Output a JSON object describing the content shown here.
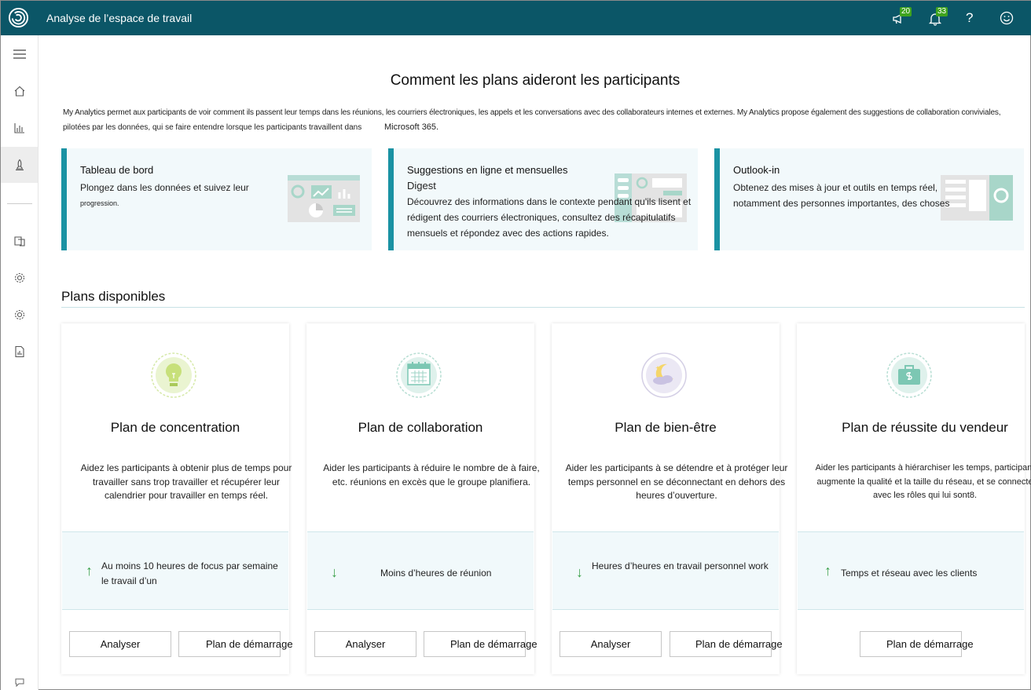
{
  "app": {
    "title": "Analyse de l’espace de travail"
  },
  "topbar": {
    "announcements_badge": "20",
    "notifications_badge": "33",
    "help_label": "?"
  },
  "page": {
    "title": "Comment les plans aideront les participants",
    "intro_line1": "My Analytics permet aux participants de voir comment ils passent leur temps dans les réunions, les courriers électroniques, les appels et les conversations avec des collaborateurs internes et externes. My Analytics propose également des suggestions de collaboration conviviales,",
    "intro_line2": "pilotées par les données, qui se faire entendre lorsque les participants travaillent dans",
    "intro_product": "Microsoft 365."
  },
  "features": [
    {
      "title": "Tableau de bord",
      "description": "Plongez dans les données et suivez leur",
      "description_small": "progression."
    },
    {
      "title": "Suggestions en ligne et mensuelles",
      "subtitle": "Digest",
      "description": "Découvrez des informations dans le contexte pendant qu'ils lisent et rédigent des courriers électroniques, consultez des récapitulatifs mensuels et répondez avec des actions rapides."
    },
    {
      "title": "Outlook-in",
      "description": "Obtenez des mises à jour et outils en temps réel, notamment des personnes importantes, des choses"
    }
  ],
  "plans_section": {
    "title": "Plans disponibles"
  },
  "plans": [
    {
      "title": "Plan de concentration",
      "description": "Aidez les participants à obtenir plus de temps pour travailler sans trop travailler et récupérer leur calendrier pour travailler en temps réel.",
      "metric_direction": "up",
      "metric_arrow": "↑",
      "metric": "Au moins 10 heures de focus par semaine le travail d’un",
      "analyze_label": "Analyser",
      "start_label": "Plan de démarrage"
    },
    {
      "title": "Plan de collaboration",
      "description": "Aider les participants à réduire le nombre de à faire, etc. réunions en excès que le groupe planifiera.",
      "metric_direction": "down",
      "metric_arrow": "↓",
      "metric": "Moins d’heures de réunion",
      "analyze_label": "Analyser",
      "start_label": "Plan de démarrage"
    },
    {
      "title": "Plan de bien-être",
      "description": "Aider les participants à se détendre et à protéger leur temps personnel en se déconnectant en dehors des heures d’ouverture.",
      "metric_direction": "down",
      "metric_arrow": "↓",
      "metric": "Heures d’heures en travail personnel work",
      "analyze_label": "Analyser",
      "start_label": "Plan de démarrage"
    },
    {
      "title": "Plan de réussite du vendeur",
      "description": "Aider les participants à hiérarchiser les temps, participant augmente la qualité et la taille du réseau, et se connecte avec les rôles qui lui sont8.",
      "metric_direction": "up",
      "metric_arrow": "↑",
      "metric": "Temps et réseau avec les clients",
      "start_label": "Plan de démarrage"
    }
  ],
  "colors": {
    "header": "#0b5667",
    "accent": "#1a92a3",
    "metric_bg": "#f1f9fb",
    "up_arrow": "#3aa04a"
  }
}
